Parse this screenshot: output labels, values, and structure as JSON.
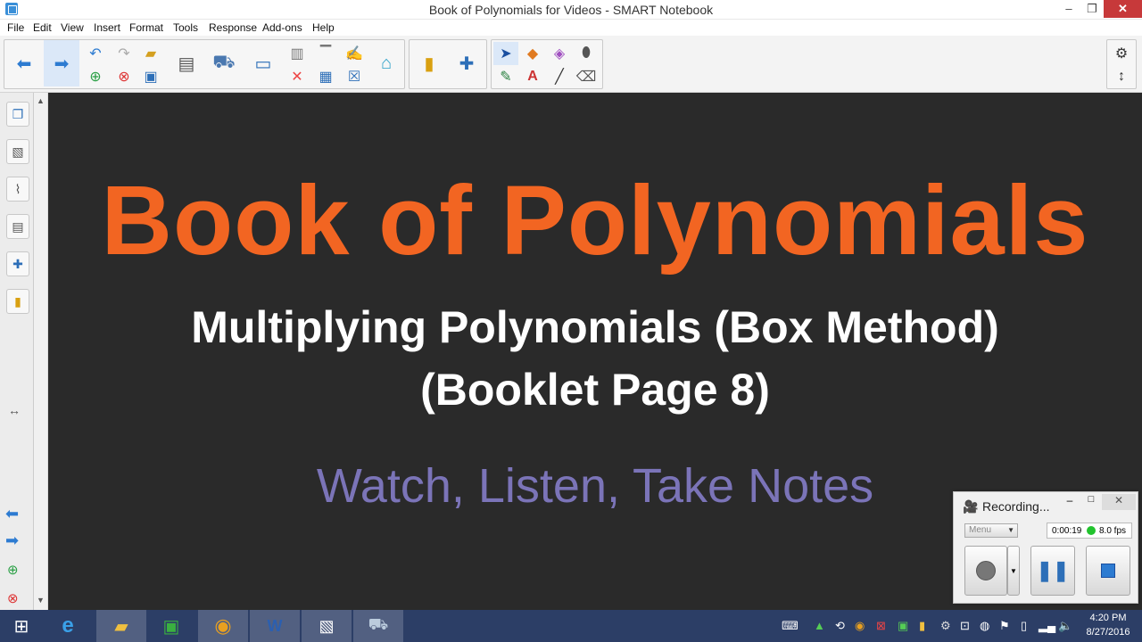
{
  "window": {
    "title": "Book of Polynomials for Videos - SMART Notebook",
    "min": "‒",
    "max": "❐",
    "close": "✕"
  },
  "menu": [
    "File",
    "Edit",
    "View",
    "Insert",
    "Format",
    "Tools",
    "Response",
    "Add-ons",
    "Help"
  ],
  "slide": {
    "title": "Book of Polynomials",
    "subtitle_line1": "Multiplying Polynomials (Box Method)",
    "subtitle_line2": "(Booklet Page 8)",
    "note": "Watch, Listen, Take Notes"
  },
  "recorder": {
    "title": "Recording...",
    "menu_label": "Menu",
    "time": "0:00:19",
    "fps": "8.0 fps",
    "min": "‒",
    "max": "□",
    "close": "✕"
  },
  "taskbar": {
    "time": "4:20 PM",
    "date": "8/27/2016"
  },
  "colors": {
    "title_orange": "#f26522",
    "note_purple": "#7b74b8",
    "canvas_bg": "#2a2a2a",
    "close_red": "#c7393a"
  }
}
